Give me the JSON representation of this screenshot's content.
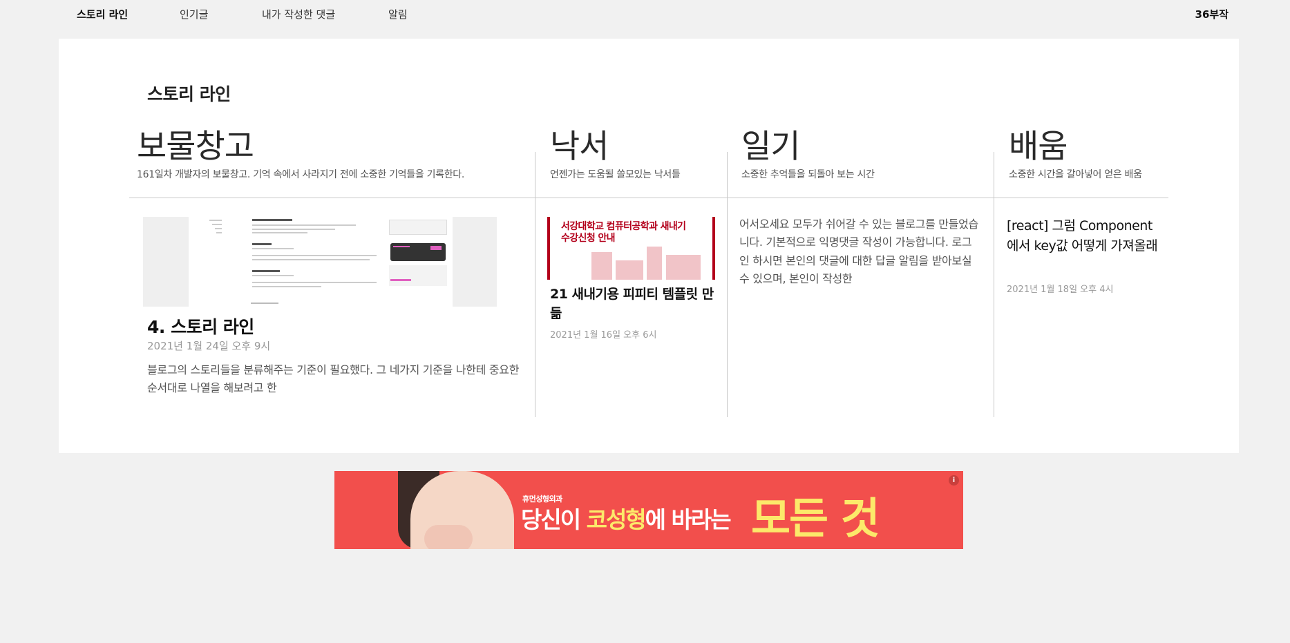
{
  "nav": {
    "items": [
      {
        "label": "스토리 라인",
        "active": true
      },
      {
        "label": "인기글",
        "active": false
      },
      {
        "label": "내가 작성한 댓글",
        "active": false
      },
      {
        "label": "알림",
        "active": false
      }
    ],
    "brand": "36부작"
  },
  "main": {
    "section_title": "스토리 라인",
    "columns": [
      {
        "title": "보물창고",
        "subtitle": "161일차 개발자의 보물창고. 기억 속에서 사라지기 전에 소중한 기억들을 기록한다.",
        "post": {
          "title": "4. 스토리 라인",
          "date": "2021년 1월 24일 오후 9시",
          "excerpt": "블로그의 스토리들을 분류해주는 기준이 필요했다. 그 네가지 기준을 나한테 중요한 순서대로 나열을 해보려고 한"
        }
      },
      {
        "title": "낙서",
        "subtitle": "언젠가는 도움될 쓸모있는 낙서들",
        "post": {
          "thumb_text_1": "서강대학교 컴퓨터공학과 새내기",
          "thumb_text_2": "수강신청 안내",
          "title": "21 새내기용 피피티 템플릿 만듦",
          "date": "2021년 1월 16일 오후 6시"
        }
      },
      {
        "title": "일기",
        "subtitle": "소중한 추억들을 되돌아 보는 시간",
        "post": {
          "excerpt": "어서오세요 모두가 쉬어갈 수 있는 블로그를 만들었습니다. 기본적으로 익명댓글 작성이 가능합니다. 로그인 하시면 본인의 댓글에 대한 답글 알림을 받아보실 수 있으며, 본인이 작성한"
        }
      },
      {
        "title": "배움",
        "subtitle": "소중한 시간을 갈아넣어 얻은 배움",
        "post": {
          "title": "[react] 그럼 Component에서 key값 어떻게 가져올래",
          "date": "2021년 1월 18일 오후 4시"
        }
      }
    ]
  },
  "ad": {
    "small": "휴먼성형외과",
    "line1_a": "당신이 ",
    "line1_b": "코성형",
    "line1_c": "에 바라는",
    "line2": "모든 것",
    "info": "i"
  },
  "colors": {
    "background": "#f1f1f1",
    "card": "#ffffff",
    "accent_red": "#b3001b",
    "ad_red": "#f24f4c",
    "ad_yellow": "#fce96a"
  }
}
